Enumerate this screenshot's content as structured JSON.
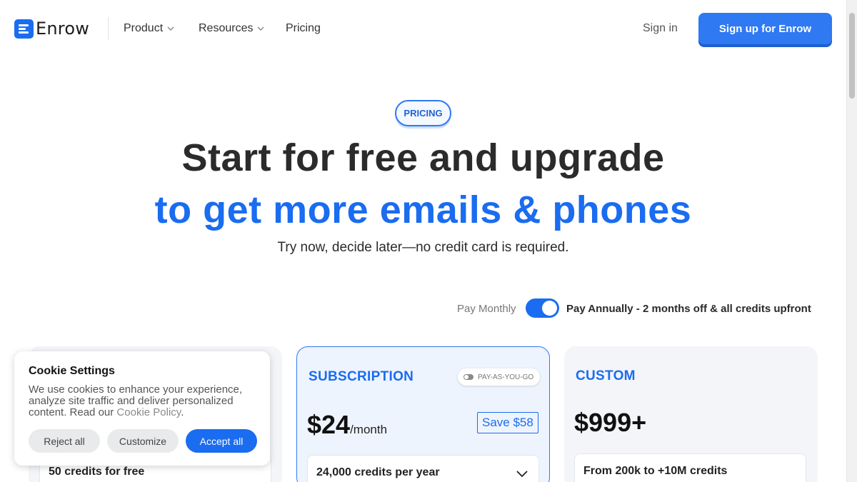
{
  "brand": {
    "name": "Enrow",
    "color": "#1a6cf0"
  },
  "nav": {
    "items": [
      {
        "label": "Product",
        "has_dropdown": true
      },
      {
        "label": "Resources",
        "has_dropdown": true
      },
      {
        "label": "Pricing",
        "has_dropdown": false
      }
    ],
    "sign_in": "Sign in",
    "cta": "Sign up for Enrow"
  },
  "hero": {
    "badge": "PRICING",
    "headline_1": "Start for free and upgrade",
    "headline_2": "to get more emails & phones",
    "subtitle": "Try now, decide later—no credit card is required."
  },
  "billing": {
    "monthly_label": "Pay Monthly",
    "annually_label": "Pay Annually - 2 months off & all credits upfront",
    "annual_selected": true
  },
  "plans": {
    "free": {
      "credits": "50 credits for free"
    },
    "subscription": {
      "title": "SUBSCRIPTION",
      "payg_label": "PAY-AS-YOU-GO",
      "price": "$24",
      "period": "/month",
      "save": "Save $58",
      "credits": "24,000 credits per year"
    },
    "custom": {
      "title": "CUSTOM",
      "price": "$999+",
      "credits": "From 200k to +10M credits"
    }
  },
  "cookie": {
    "title": "Cookie Settings",
    "text": "We use cookies to enhance your experience, analyze site traffic and deliver personalized content. Read our ",
    "link": "Cookie Policy",
    "after_link": ".",
    "reject": "Reject all",
    "customize": "Customize",
    "accept": "Accept all"
  }
}
